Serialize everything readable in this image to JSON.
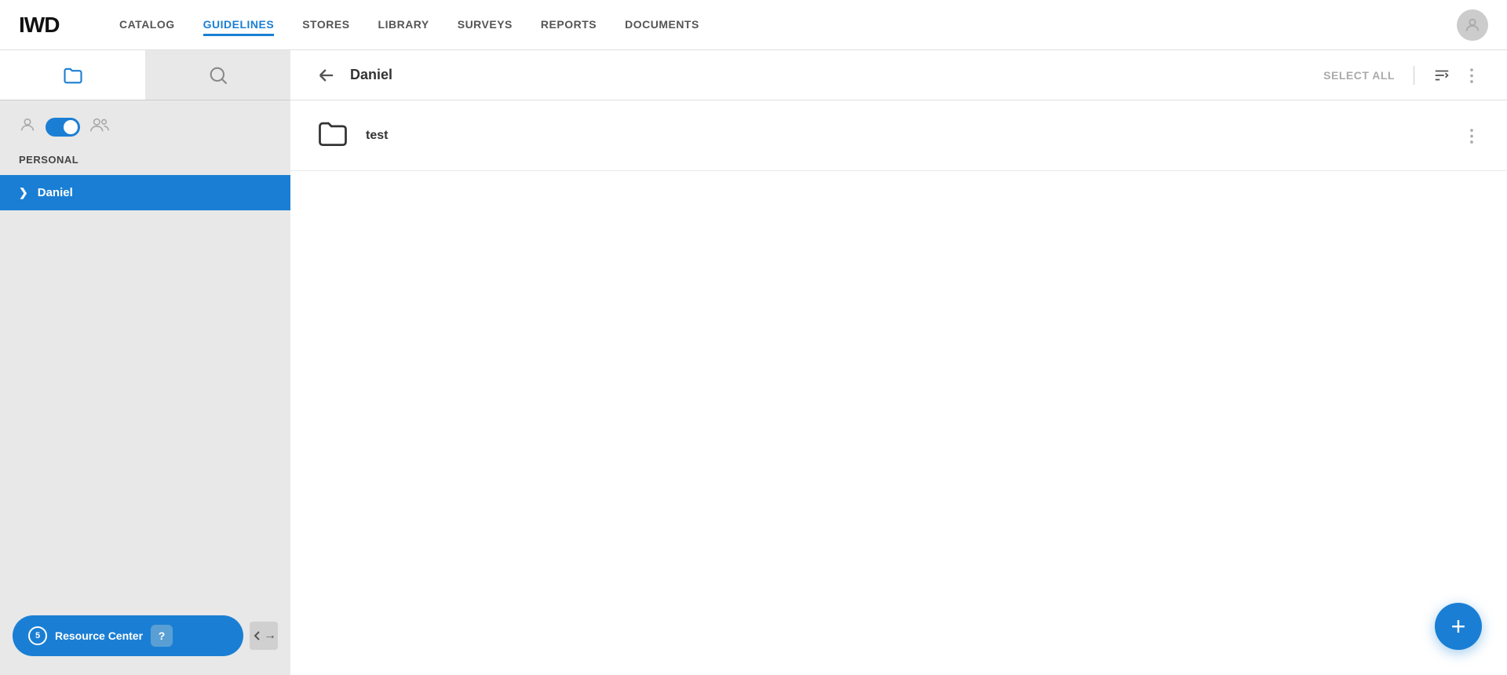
{
  "app": {
    "logo": "IWD",
    "logo_dot": "D"
  },
  "nav": {
    "items": [
      {
        "label": "CATALOG",
        "active": false
      },
      {
        "label": "GUIDELINES",
        "active": true
      },
      {
        "label": "STORES",
        "active": false
      },
      {
        "label": "LIBRARY",
        "active": false
      },
      {
        "label": "SURVEYS",
        "active": false
      },
      {
        "label": "REPORTS",
        "active": false
      },
      {
        "label": "DOCUMENTS",
        "active": false
      }
    ]
  },
  "sidebar": {
    "section_label": "PERSONAL",
    "active_item": "Daniel",
    "items": [
      {
        "label": "Daniel"
      }
    ],
    "resource_center": {
      "count": "5",
      "label": "Resource Center",
      "help": "?"
    }
  },
  "content": {
    "back_label": "Back",
    "title": "Daniel",
    "select_all": "SELECT ALL",
    "files": [
      {
        "name": "test"
      }
    ]
  }
}
